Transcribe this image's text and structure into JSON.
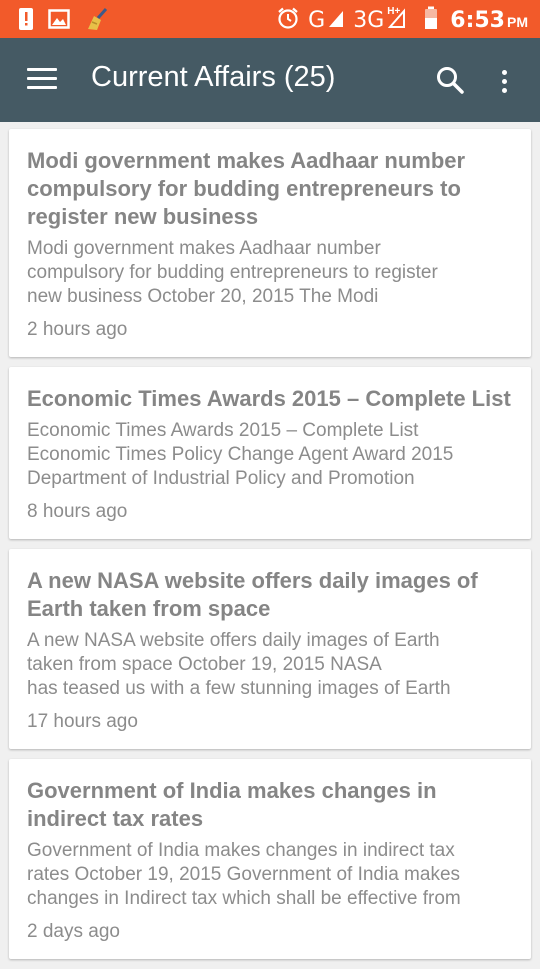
{
  "status_bar": {
    "icons_left": [
      "alert-icon",
      "image-icon",
      "broom-icon"
    ],
    "network_g": "G",
    "network_3g": "3G",
    "network_3g_sup": "H+",
    "time": "6:53",
    "ampm": "PM",
    "color": "#f25a2a"
  },
  "app_bar": {
    "title": "Current Affairs (25)",
    "color": "#455a64",
    "icons": [
      "menu-icon",
      "search-icon",
      "more-vert-icon"
    ]
  },
  "articles": [
    {
      "title": "Modi government makes Aadhaar number compulsory for budding entrepreneurs to register new business",
      "excerpt_lines": [
        "Modi government makes Aadhaar number",
        "compulsory for budding entrepreneurs to register",
        "new business October 20, 2015 The Modi"
      ],
      "time": "2 hours ago"
    },
    {
      "title": "Economic Times Awards 2015 – Complete List",
      "excerpt_lines": [
        "Economic Times Awards 2015 – Complete List",
        "Economic Times Policy Change Agent Award 2015",
        "Department of Industrial Policy and Promotion"
      ],
      "time": "8 hours ago"
    },
    {
      "title": "A new NASA website offers daily images of Earth taken from space",
      "excerpt_lines": [
        "A new NASA website offers daily images of Earth",
        "taken from space October 19, 2015 NASA",
        "has teased us with a few stunning images of Earth"
      ],
      "time": "17 hours ago"
    },
    {
      "title": "Government of India makes changes in indirect tax rates",
      "excerpt_lines": [
        "Government of India makes changes in indirect tax",
        "rates October 19, 2015 Government of India makes",
        "changes in Indirect tax which shall be effective from"
      ],
      "time": "2 days ago"
    }
  ]
}
